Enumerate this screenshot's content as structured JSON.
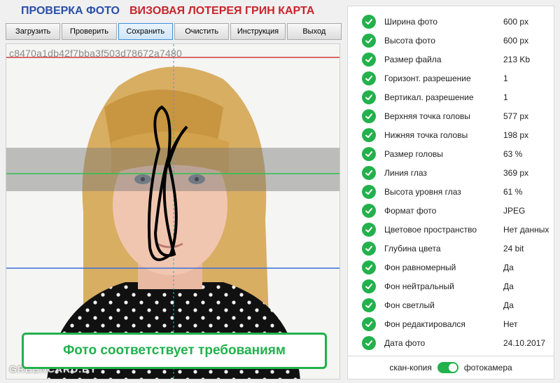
{
  "header": {
    "title_left": "ПРОВЕРКА ФОТО",
    "title_right": "ВИЗОВАЯ ЛОТЕРЕЯ ГРИН КАРТА"
  },
  "toolbar": {
    "buttons": [
      "Загрузить",
      "Проверить",
      "Сохранить",
      "Очистить",
      "Инструкция",
      "Выход"
    ]
  },
  "photo": {
    "hash": "c8470a1db42f7bba3f503d78672a7480",
    "watermark": "GREENCARD.BY",
    "status": "Фото соответствует требованиям"
  },
  "results": [
    {
      "label": "Ширина фото",
      "value": "600 px"
    },
    {
      "label": "Высота фото",
      "value": "600 px"
    },
    {
      "label": "Размер файла",
      "value": "213 Kb"
    },
    {
      "label": "Горизонт. разрешение",
      "value": "1"
    },
    {
      "label": "Вертикал. разрешение",
      "value": "1"
    },
    {
      "label": "Верхняя точка головы",
      "value": "577 px"
    },
    {
      "label": "Нижняя точка головы",
      "value": "198 px"
    },
    {
      "label": "Размер головы",
      "value": "63 %"
    },
    {
      "label": "Линия глаз",
      "value": "369 px"
    },
    {
      "label": "Высота уровня глаз",
      "value": "61 %"
    },
    {
      "label": "Формат фото",
      "value": "JPEG"
    },
    {
      "label": "Цветовое пространство",
      "value": "Нет данных"
    },
    {
      "label": "Глубина цвета",
      "value": "24 bit"
    },
    {
      "label": "Фон равномерный",
      "value": "Да"
    },
    {
      "label": "Фон нейтральный",
      "value": "Да"
    },
    {
      "label": "Фон светлый",
      "value": "Да"
    },
    {
      "label": "Фон редактировался",
      "value": "Нет"
    },
    {
      "label": "Дата фото",
      "value": "24.10.2017"
    }
  ],
  "footer": {
    "left_label": "скан-копия",
    "right_label": "фотокамера",
    "toggle_on": true
  },
  "colors": {
    "accent_green": "#22b14c",
    "title_blue": "#2a4fa8",
    "title_red": "#c8252b"
  }
}
